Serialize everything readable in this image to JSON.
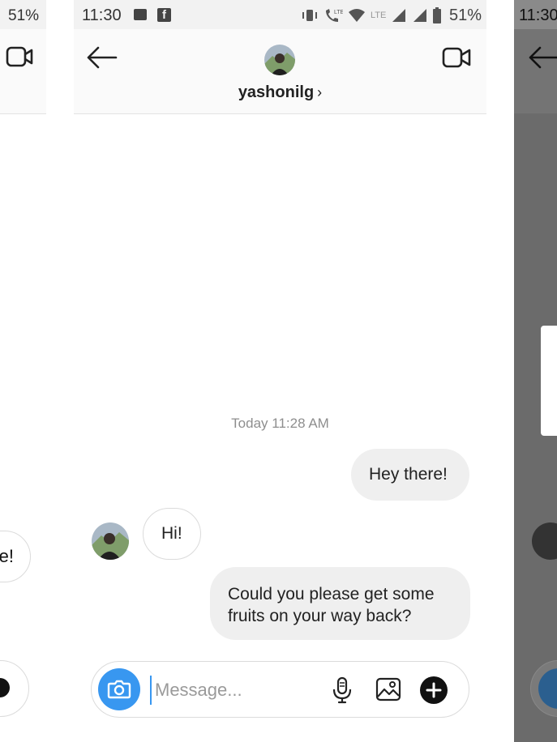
{
  "left_panel": {
    "status_battery": "51%",
    "bubble_text": "e!"
  },
  "status_bar": {
    "time": "11:30",
    "battery": "51%",
    "network_label": "LTE",
    "icons": [
      "image-icon",
      "facebook-icon",
      "vibrate-icon",
      "lte-call-icon",
      "wifi-icon",
      "signal-icon",
      "signal-icon",
      "battery-icon"
    ]
  },
  "header": {
    "username": "yashonilg",
    "chevron": "›"
  },
  "conversation": {
    "timestamp": "Today 11:28 AM",
    "messages": [
      {
        "direction": "sent",
        "text": "Hey there!"
      },
      {
        "direction": "received",
        "text": "Hi!"
      },
      {
        "direction": "sent",
        "text": "Could you please get some fruits on your way back?"
      }
    ]
  },
  "composer": {
    "placeholder": "Message..."
  },
  "right_panel": {
    "status_time": "11:30"
  },
  "colors": {
    "accent": "#3897f0",
    "sent_bubble": "#efefef",
    "border": "#dbdbdb"
  }
}
